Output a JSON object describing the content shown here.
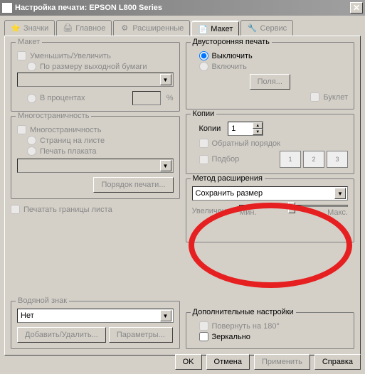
{
  "title": "Настройка печати: EPSON L800 Series",
  "tabs": {
    "icons": "Значки",
    "main": "Главное",
    "advanced": "Расширенные",
    "layout": "Макет",
    "service": "Сервис"
  },
  "layout_group": {
    "legend": "Макет",
    "reduce_enlarge": "Уменьшить/Увеличить",
    "fit_output": "По размеру выходной бумаги",
    "percent": "В процентах",
    "pct_sign": "%"
  },
  "multipage": {
    "legend": "Многостраничность",
    "pages_per_sheet": "Страниц на листе",
    "poster": "Печать плаката",
    "page_order": "Порядок печати..."
  },
  "print_borders": "Печатать границы листа",
  "watermark": {
    "legend": "Водяной знак",
    "none": "Нет",
    "add_remove": "Добавить/Удалить...",
    "settings": "Параметры..."
  },
  "duplex": {
    "legend": "Двусторонняя печать",
    "off": "Выключить",
    "on": "Включить",
    "margins": "Поля...",
    "booklet": "Буклет"
  },
  "copies": {
    "legend": "Копии",
    "copies_label": "Копии",
    "count": "1",
    "reverse": "Обратный порядок",
    "collate": "Подбор"
  },
  "expand": {
    "legend": "Метод расширения",
    "keep_size": "Сохранить размер",
    "zoom": "Увеличение",
    "min": "Мин.",
    "max": "Макс."
  },
  "extra": {
    "legend": "Дополнительные настройки",
    "rotate": "Повернуть на 180°",
    "mirror": "Зеркально"
  },
  "buttons": {
    "ok": "OK",
    "cancel": "Отмена",
    "apply": "Применить",
    "help": "Справка"
  }
}
